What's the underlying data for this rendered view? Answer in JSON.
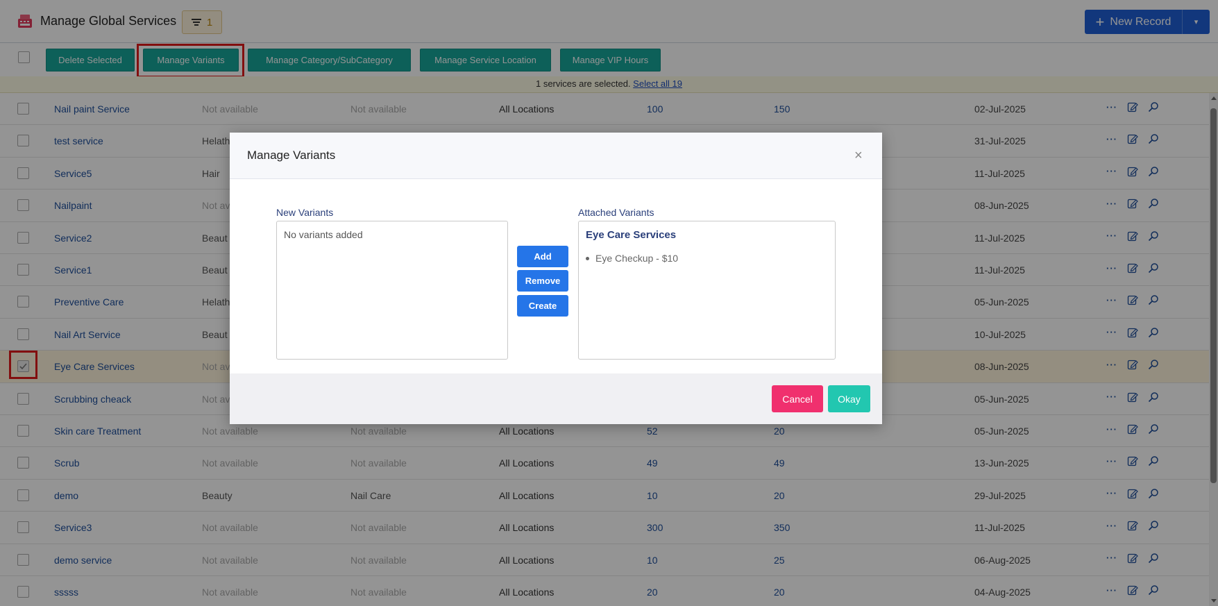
{
  "header": {
    "title": "Manage Global Services",
    "filter_count": "1",
    "new_record_label": "New Record"
  },
  "toolbar": {
    "buttons": [
      "Delete Selected",
      "Manage Variants",
      "Manage Category/SubCategory",
      "Manage Service Location",
      "Manage VIP Hours"
    ]
  },
  "selection": {
    "text": "1 services are selected. ",
    "select_all": "Select all 19"
  },
  "rows": [
    {
      "name": "Nail paint Service",
      "category": "Not available",
      "subcategory": "Not available",
      "location": "All Locations",
      "p1": "100",
      "p2": "150",
      "date": "02-Jul-2025",
      "checked": false
    },
    {
      "name": "test service",
      "category": "Helath",
      "subcategory": "",
      "location": "",
      "p1": "",
      "p2": "",
      "date": "31-Jul-2025",
      "checked": false
    },
    {
      "name": "Service5",
      "category": "Hair",
      "subcategory": "",
      "location": "",
      "p1": "",
      "p2": "",
      "date": "11-Jul-2025",
      "checked": false
    },
    {
      "name": "Nailpaint",
      "category": "Not av",
      "subcategory": "",
      "location": "",
      "p1": "",
      "p2": "",
      "date": "08-Jun-2025",
      "checked": false
    },
    {
      "name": "Service2",
      "category": "Beaut",
      "subcategory": "",
      "location": "",
      "p1": "",
      "p2": "",
      "date": "11-Jul-2025",
      "checked": false
    },
    {
      "name": "Service1",
      "category": "Beaut",
      "subcategory": "",
      "location": "",
      "p1": "",
      "p2": "",
      "date": "11-Jul-2025",
      "checked": false
    },
    {
      "name": "Preventive Care",
      "category": "Helath",
      "subcategory": "",
      "location": "",
      "p1": "",
      "p2": "",
      "date": "05-Jun-2025",
      "checked": false
    },
    {
      "name": "Nail Art Service",
      "category": "Beaut",
      "subcategory": "",
      "location": "",
      "p1": "",
      "p2": "",
      "date": "10-Jul-2025",
      "checked": false
    },
    {
      "name": "Eye Care Services",
      "category": "Not av",
      "subcategory": "",
      "location": "",
      "p1": "",
      "p2": "",
      "date": "08-Jun-2025",
      "checked": true
    },
    {
      "name": "Scrubbing cheack",
      "category": "Not av",
      "subcategory": "",
      "location": "",
      "p1": "",
      "p2": "",
      "date": "05-Jun-2025",
      "checked": false
    },
    {
      "name": "Skin care Treatment",
      "category": "Not available",
      "subcategory": "Not available",
      "location": "All Locations",
      "p1": "52",
      "p2": "20",
      "date": "05-Jun-2025",
      "checked": false
    },
    {
      "name": "Scrub",
      "category": "Not available",
      "subcategory": "Not available",
      "location": "All Locations",
      "p1": "49",
      "p2": "49",
      "date": "13-Jun-2025",
      "checked": false
    },
    {
      "name": "demo",
      "category": "Beauty",
      "subcategory": "Nail Care",
      "location": "All Locations",
      "p1": "10",
      "p2": "20",
      "date": "29-Jul-2025",
      "checked": false
    },
    {
      "name": "Service3",
      "category": "Not available",
      "subcategory": "Not available",
      "location": "All Locations",
      "p1": "300",
      "p2": "350",
      "date": "11-Jul-2025",
      "checked": false
    },
    {
      "name": "demo service",
      "category": "Not available",
      "subcategory": "Not available",
      "location": "All Locations",
      "p1": "10",
      "p2": "25",
      "date": "06-Aug-2025",
      "checked": false
    },
    {
      "name": "sssss",
      "category": "Not available",
      "subcategory": "Not available",
      "location": "All Locations",
      "p1": "20",
      "p2": "20",
      "date": "04-Aug-2025",
      "checked": false
    }
  ],
  "modal": {
    "title": "Manage Variants",
    "new_variants_label": "New Variants",
    "new_variants_empty": "No variants added",
    "attached_variants_label": "Attached Variants",
    "attached_group": "Eye Care Services",
    "attached_items": [
      "Eye Checkup - $10"
    ],
    "add_label": "Add",
    "remove_label": "Remove",
    "create_label": "Create",
    "cancel_label": "Cancel",
    "okay_label": "Okay",
    "close_symbol": "×"
  },
  "colors": {
    "primary": "#1f5fd6",
    "teal": "#17a59a",
    "cancel": "#f0306e",
    "okay": "#22c7b0"
  }
}
